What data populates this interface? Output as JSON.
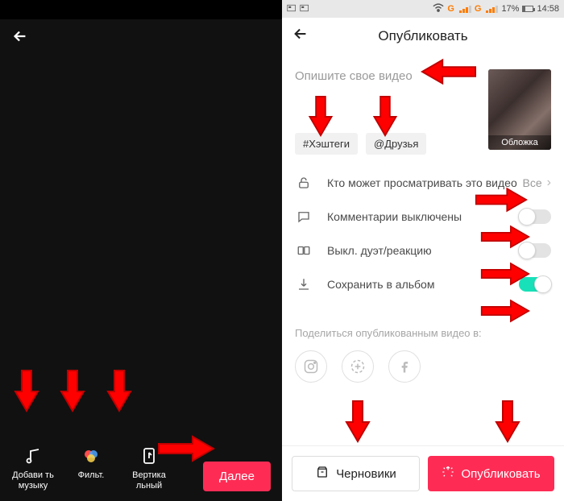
{
  "left": {
    "editor": {
      "add_music": "Добави ть музыку",
      "filters": "Фильт.",
      "vertical": "Вертика льный"
    },
    "next_button": "Далее"
  },
  "right": {
    "statusbar": {
      "battery_text": "17%",
      "time": "14:58",
      "net_g_1": "G",
      "net_g_2": "G"
    },
    "header": "Опубликовать",
    "description_placeholder": "Опишите свое видео",
    "chips": {
      "hashtags": "#Хэштеги",
      "friends": "@Друзья"
    },
    "cover_label": "Обложка",
    "rows": {
      "privacy": {
        "label": "Кто может просматривать это видео",
        "value": "Все"
      },
      "comments": {
        "label": "Комментарии выключены"
      },
      "duet": {
        "label": "Выкл. дуэт/реакцию"
      },
      "save": {
        "label": "Сохранить в альбом"
      }
    },
    "share_label": "Поделиться опубликованным видео в:",
    "buttons": {
      "drafts": "Черновики",
      "publish": "Опубликовать"
    }
  }
}
